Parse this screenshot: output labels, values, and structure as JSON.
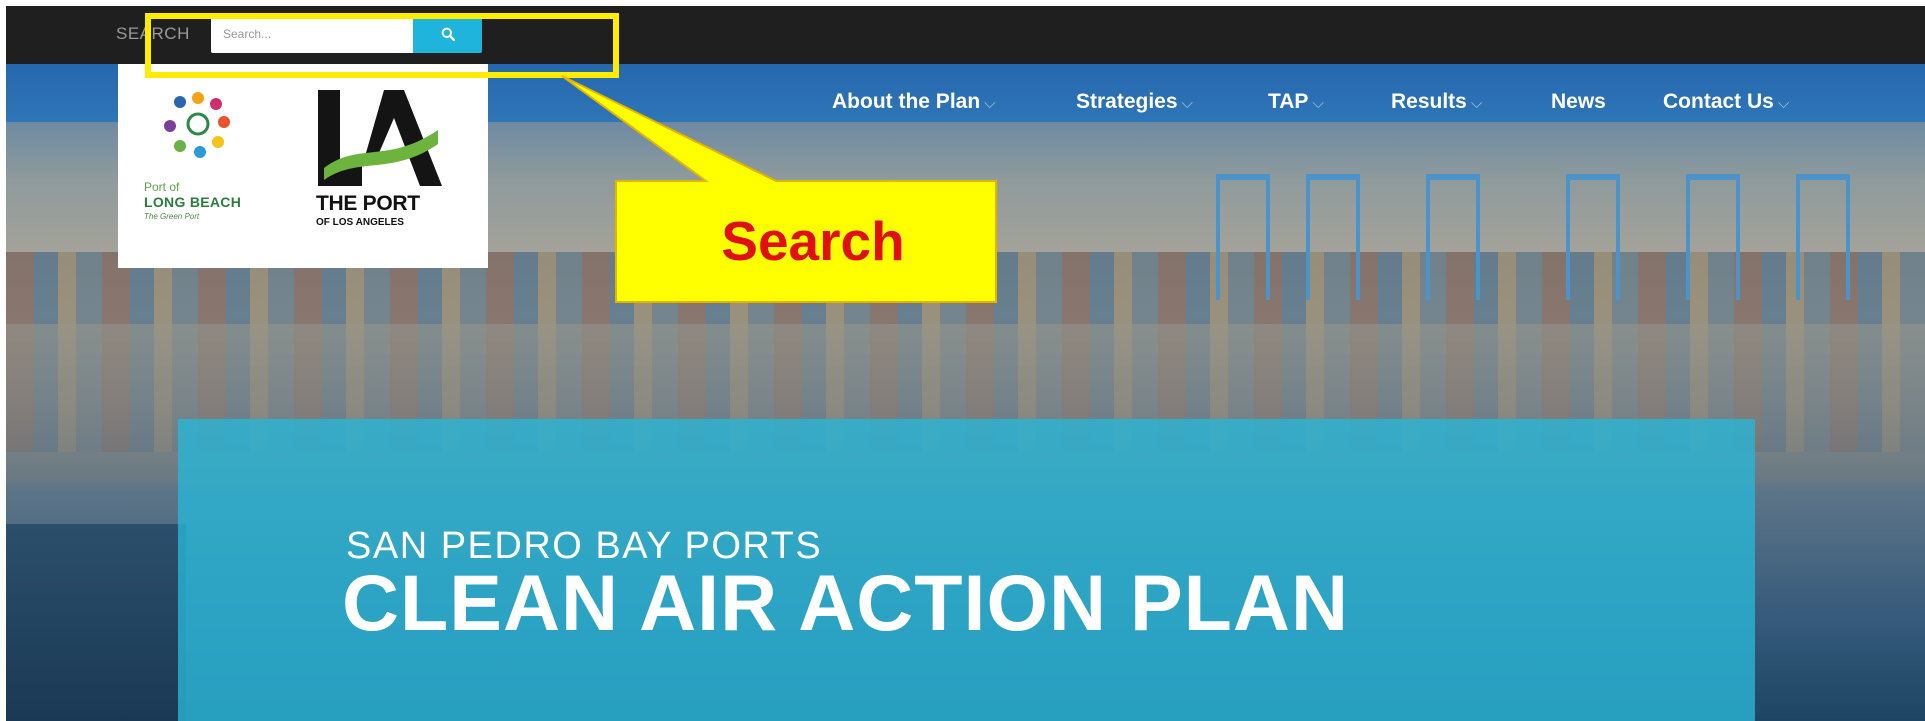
{
  "search": {
    "label": "SEARCH",
    "placeholder": "Search...",
    "button_icon": "search-icon"
  },
  "logos": {
    "long_beach": {
      "line1": "Port of",
      "line2": "LONG BEACH",
      "line3": "The Green Port"
    },
    "los_angeles": {
      "mark": "LA",
      "line1": "THE PORT",
      "line2": "OF LOS ANGELES"
    }
  },
  "nav": {
    "items": [
      {
        "label": "About the Plan",
        "has_dropdown": true
      },
      {
        "label": "Strategies",
        "has_dropdown": true
      },
      {
        "label": "TAP",
        "has_dropdown": true
      },
      {
        "label": "Results",
        "has_dropdown": true
      },
      {
        "label": "News",
        "has_dropdown": false
      },
      {
        "label": "Contact Us",
        "has_dropdown": true
      }
    ],
    "chevron": "⌵"
  },
  "hero": {
    "subtitle": "SAN PEDRO BAY PORTS",
    "title": "CLEAN AIR ACTION PLAN"
  },
  "annotation": {
    "label": "Search",
    "highlight_color": "#ffec00",
    "text_color": "#e01010"
  },
  "colors": {
    "topbar": "#1f1f1f",
    "search_button": "#1fb4dc",
    "nav_blue": "#2a6fb3",
    "title_box": "#29b5d6"
  }
}
